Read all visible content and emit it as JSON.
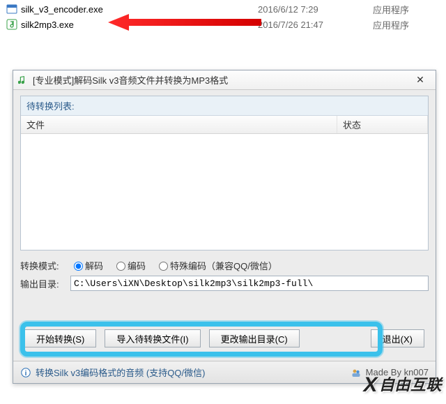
{
  "files": [
    {
      "icon": "exe-blue",
      "name": "silk_v3_encoder.exe",
      "date": "2016/6/12 7:29",
      "type": "应用程序"
    },
    {
      "icon": "exe-green",
      "name": "silk2mp3.exe",
      "date": "2016/7/26 21:47",
      "type": "应用程序"
    }
  ],
  "dialog": {
    "title": "[专业模式]解码Silk v3音频文件并转换为MP3格式",
    "list_title": "待转换列表:",
    "col_file": "文件",
    "col_state": "状态",
    "mode_label": "转换模式:",
    "mode_options": {
      "decode": "解码",
      "encode": "编码",
      "special": "特殊编码（兼容QQ/微信）"
    },
    "mode_selected": "decode",
    "output_label": "输出目录:",
    "output_path": "C:\\Users\\iXN\\Desktop\\silk2mp3\\silk2mp3-full\\",
    "buttons": {
      "start": "开始转换(S)",
      "import": "导入待转换文件(I)",
      "change_dir": "更改输出目录(C)",
      "exit": "退出(X)"
    },
    "status": "转换Silk v3编码格式的音频 (支持QQ/微信)",
    "made_by": "Made By kn007"
  },
  "watermark": "自由互联"
}
